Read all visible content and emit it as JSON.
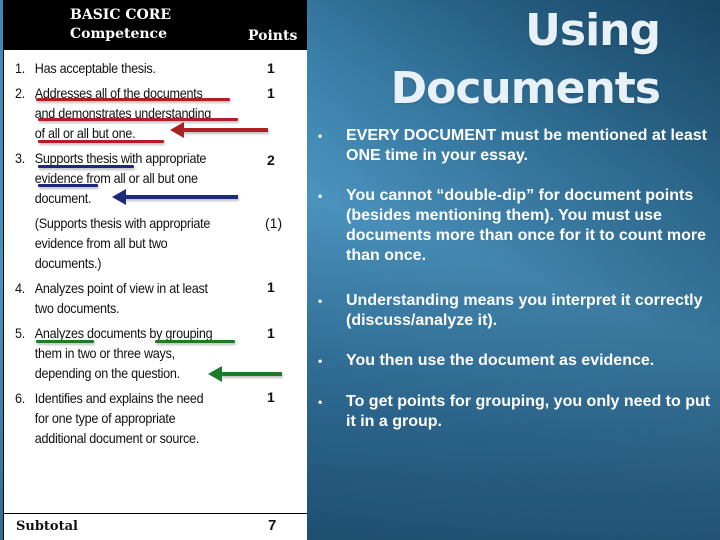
{
  "rubric": {
    "header": {
      "title_line1": "BASIC CORE",
      "title_line2": "Competence",
      "points_label": "Points"
    },
    "items": [
      {
        "num": "1.",
        "lines": [
          "Has acceptable thesis."
        ],
        "points": "1"
      },
      {
        "num": "2.",
        "lines": [
          "Addresses all of the documents",
          "and demonstrates understanding",
          "of all or all but one."
        ],
        "points": "1"
      },
      {
        "num": "3.",
        "lines": [
          "Supports thesis with appropriate",
          "evidence from all or all but one",
          "document."
        ],
        "points": "2"
      },
      {
        "num": "",
        "lines": [
          "(Supports thesis with appropriate",
          "evidence from all but two",
          "documents.)"
        ],
        "points": "(1)"
      },
      {
        "num": "4.",
        "lines": [
          "Analyzes point of view in at least",
          "two documents."
        ],
        "points": "1"
      },
      {
        "num": "5.",
        "lines": [
          "Analyzes documents by grouping",
          "them in two or three ways,",
          "depending on the question."
        ],
        "points": "1"
      },
      {
        "num": "6.",
        "lines": [
          "Identifies and explains the need",
          "for one type of appropriate",
          "additional document or source."
        ],
        "points": "1"
      }
    ],
    "subtotal": {
      "label": "Subtotal",
      "value": "7"
    },
    "annotation_colors": {
      "red": "#b01f24",
      "blue": "#1d2a7a",
      "green": "#1f7a2a"
    }
  },
  "slide": {
    "title_line1": "Using",
    "title_line2": "Documents",
    "bullets": [
      "EVERY DOCUMENT must be mentioned at least ONE time in your essay.",
      "You cannot “double-dip” for document points (besides mentioning them). You must use documents more than once for it to count more than once.",
      "Understanding means you interpret it correctly (discuss/analyze it).",
      "You then use the document as evidence.",
      "To get points for grouping, you only need to put it in a group."
    ],
    "bullet_symbol": "•",
    "background_color": "#3a80aa"
  }
}
